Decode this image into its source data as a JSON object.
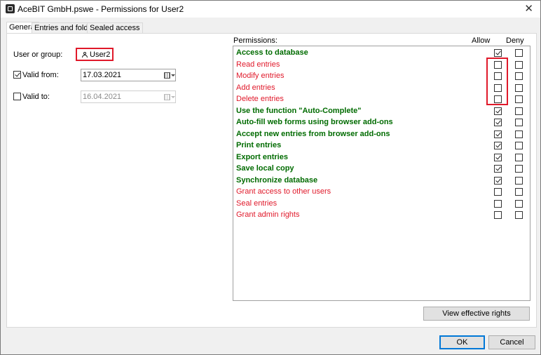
{
  "window": {
    "title": "AceBIT GmbH.pswe - Permissions for User2",
    "close_glyph": "✕"
  },
  "tabs": [
    {
      "label": "General",
      "active": true
    },
    {
      "label": "Entries and folders",
      "active": false
    },
    {
      "label": "Sealed access",
      "active": false
    }
  ],
  "general": {
    "user_label": "User or group:",
    "user_value": "User2",
    "valid_from": {
      "label": "Valid from:",
      "checked": true,
      "date": "17.03.2021"
    },
    "valid_to": {
      "label": "Valid to:",
      "checked": false,
      "date": "16.04.2021"
    }
  },
  "permissions": {
    "header": "Permissions:",
    "allow_header": "Allow",
    "deny_header": "Deny",
    "items": [
      {
        "label": "Access to database",
        "style": "green",
        "allow": true,
        "deny": false
      },
      {
        "label": "Read entries",
        "style": "red",
        "allow": false,
        "deny": false
      },
      {
        "label": "Modify entries",
        "style": "red",
        "allow": false,
        "deny": false
      },
      {
        "label": "Add entries",
        "style": "red",
        "allow": false,
        "deny": false
      },
      {
        "label": "Delete entries",
        "style": "red",
        "allow": false,
        "deny": false
      },
      {
        "label": "Use the function \"Auto-Complete\"",
        "style": "green",
        "allow": true,
        "deny": false
      },
      {
        "label": "Auto-fill web forms using browser add-ons",
        "style": "green",
        "allow": true,
        "deny": false
      },
      {
        "label": "Accept new entries from browser add-ons",
        "style": "green",
        "allow": true,
        "deny": false
      },
      {
        "label": "Print entries",
        "style": "green",
        "allow": true,
        "deny": false
      },
      {
        "label": "Export entries",
        "style": "green",
        "allow": true,
        "deny": false
      },
      {
        "label": "Save local copy",
        "style": "green",
        "allow": true,
        "deny": false
      },
      {
        "label": "Synchronize database",
        "style": "green",
        "allow": true,
        "deny": false
      },
      {
        "label": "Grant access to other users",
        "style": "red",
        "allow": false,
        "deny": false
      },
      {
        "label": "Seal entries",
        "style": "red",
        "allow": false,
        "deny": false
      },
      {
        "label": "Grant admin rights",
        "style": "red",
        "allow": false,
        "deny": false
      }
    ]
  },
  "buttons": {
    "view_rights": "View effective rights",
    "ok": "OK",
    "cancel": "Cancel"
  }
}
